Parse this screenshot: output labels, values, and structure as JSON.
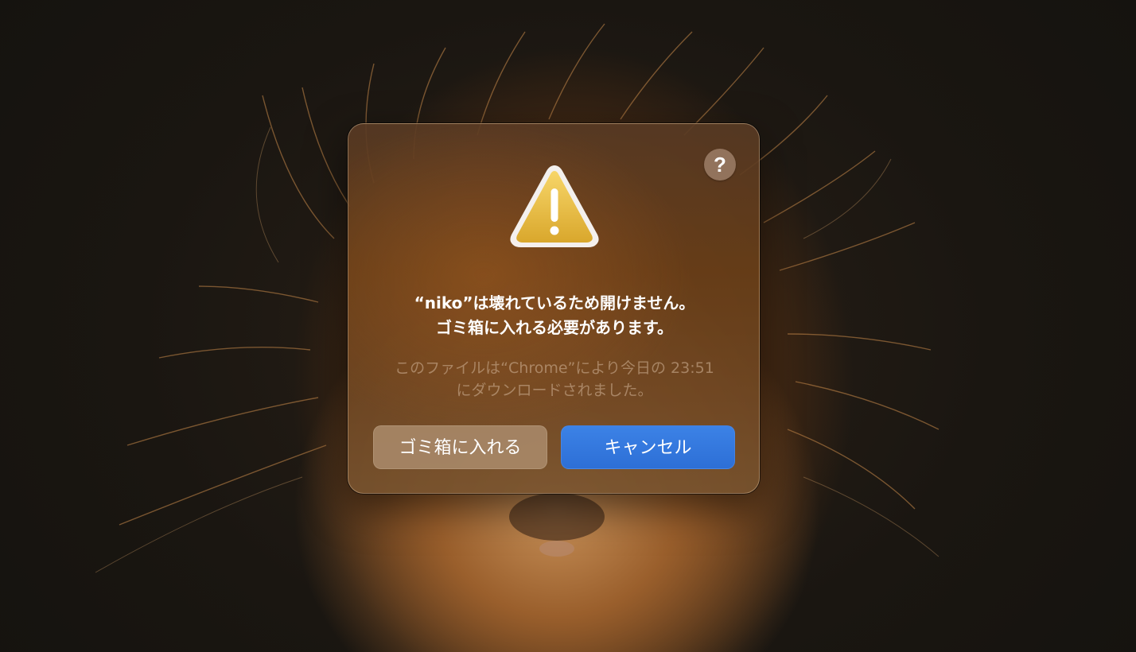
{
  "alert": {
    "help_label": "?",
    "icon": "warning-triangle-icon",
    "title_line1": "“niko”は壊れているため開けません。",
    "title_line2": "ゴミ箱に入れる必要があります。",
    "message_line1": "このファイルは“Chrome”により今日の 23:51",
    "message_line2": "にダウンロードされました。",
    "buttons": {
      "trash_label": "ゴミ箱に入れる",
      "cancel_label": "キャンセル"
    }
  },
  "colors": {
    "accent_blue": "#2f74db",
    "warning_yellow": "#f0c33c",
    "dialog_tint": "#6a4220"
  }
}
